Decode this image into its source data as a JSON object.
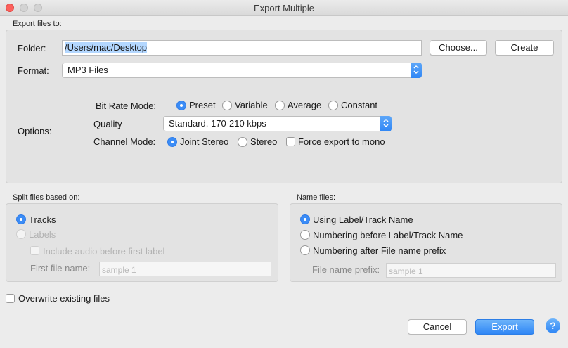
{
  "window": {
    "title": "Export Multiple"
  },
  "export_to": {
    "group_title": "Export files to:",
    "folder_label": "Folder:",
    "folder_value": "/Users/mac/Desktop",
    "choose_label": "Choose...",
    "create_label": "Create",
    "format_label": "Format:",
    "format_value": "MP3 Files"
  },
  "options": {
    "label": "Options:",
    "bit_rate_mode_label": "Bit Rate Mode:",
    "bit_rate_modes": [
      "Preset",
      "Variable",
      "Average",
      "Constant"
    ],
    "bit_rate_selected": "Preset",
    "quality_label": "Quality",
    "quality_value": "Standard, 170-210 kbps",
    "channel_mode_label": "Channel Mode:",
    "channel_modes": [
      "Joint Stereo",
      "Stereo"
    ],
    "channel_selected": "Joint Stereo",
    "force_mono_label": "Force export to mono"
  },
  "split": {
    "group_title": "Split files based on:",
    "tracks_label": "Tracks",
    "labels_label": "Labels",
    "include_audio_label": "Include audio before first label",
    "first_file_name_label": "First file name:",
    "first_file_name_placeholder": "sample 1",
    "selected": "Tracks"
  },
  "name_files": {
    "group_title": "Name files:",
    "options": [
      "Using Label/Track Name",
      "Numbering before Label/Track Name",
      "Numbering after File name prefix"
    ],
    "selected": "Using Label/Track Name",
    "prefix_label": "File name prefix:",
    "prefix_placeholder": "sample 1"
  },
  "overwrite_label": "Overwrite existing files",
  "footer": {
    "cancel_label": "Cancel",
    "export_label": "Export",
    "help_label": "?"
  },
  "colors": {
    "accent": "#3b8cf6",
    "close_button": "#fc605c",
    "selection": "#b3d7ff"
  }
}
